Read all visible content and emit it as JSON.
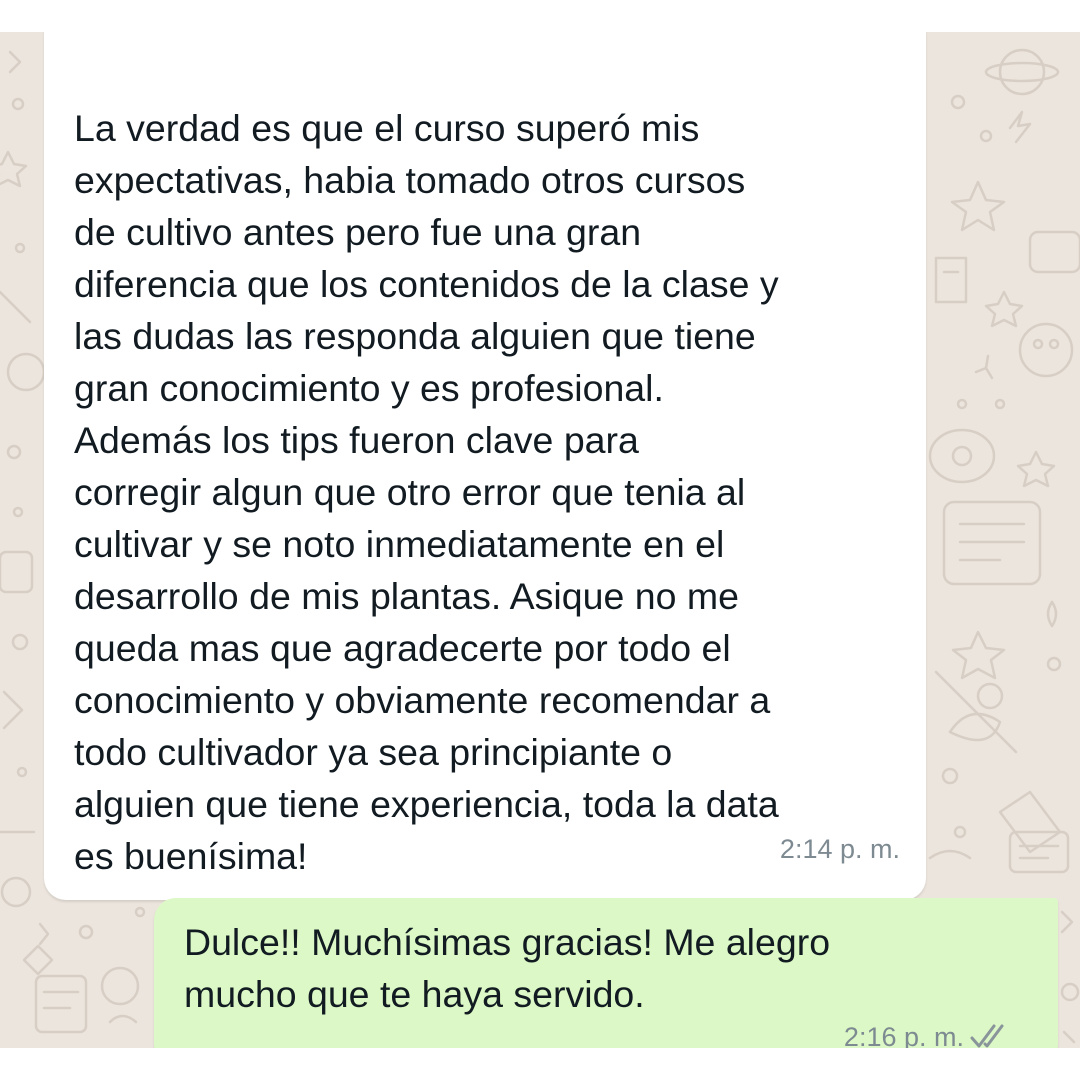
{
  "messages": {
    "incoming": {
      "text": "La verdad es que el curso superó mis\nexpectativas, habia tomado otros cursos\nde cultivo antes pero fue una gran\ndiferencia que los contenidos de la clase y\nlas dudas las responda alguien que tiene\ngran conocimiento y es profesional.\nAdemás los tips fueron clave para\ncorregir algun que otro error que tenia al\ncultivar y se noto inmediatamente en el\ndesarrollo de mis plantas. Asique no me\nqueda mas que agradecerte por todo el\nconocimiento y obviamente recomendar a\ntodo cultivador ya sea principiante o\nalguien que tiene experiencia, toda la data\nes buenísima!",
      "time": "2:14 p. m."
    },
    "outgoing": {
      "text": "Dulce!! Muchísimas gracias! Me alegro\nmucho que te haya servido.",
      "time": "2:16 p. m.",
      "status_icon": "double-check-icon"
    }
  },
  "colors": {
    "chat_background": "#ece5dd",
    "incoming_bubble": "#ffffff",
    "outgoing_bubble": "#dcf8c6",
    "timestamp": "#7d8a91"
  }
}
